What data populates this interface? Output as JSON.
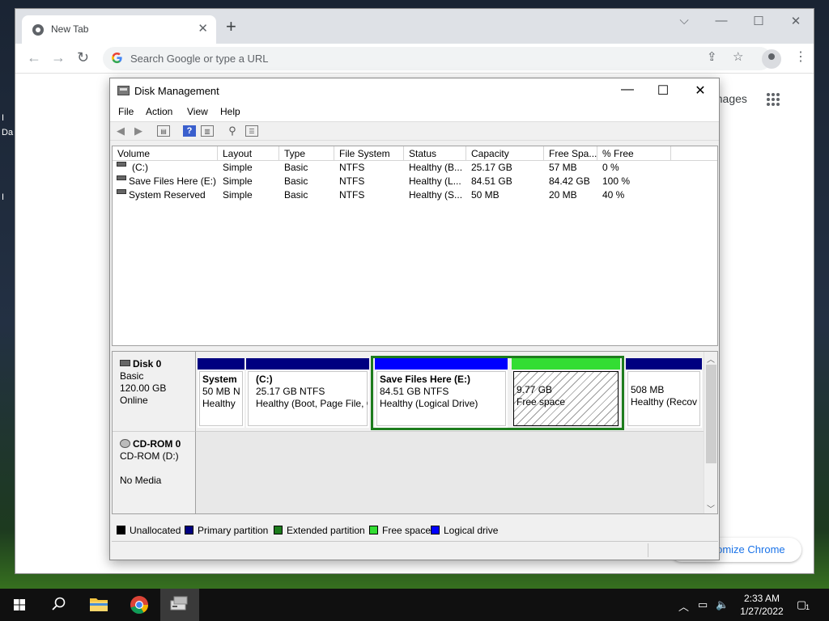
{
  "desktop": {
    "edge_letters": [
      "I",
      "Da",
      "I"
    ]
  },
  "chrome": {
    "tab_title": "New Tab",
    "omnibox_placeholder": "Search Google or type a URL",
    "images_link": "Images",
    "customize_button": "Customize Chrome",
    "customize_visible": "stomize Chrome"
  },
  "disk_management": {
    "title": "Disk Management",
    "menu": [
      "File",
      "Action",
      "View",
      "Help"
    ],
    "columns": [
      "Volume",
      "Layout",
      "Type",
      "File System",
      "Status",
      "Capacity",
      "Free Spa...",
      "% Free"
    ],
    "rows": [
      {
        "volume": "(C:)",
        "layout": "Simple",
        "type": "Basic",
        "fs": "NTFS",
        "status": "Healthy (B...",
        "capacity": "25.17 GB",
        "free": "57 MB",
        "pct": "0 %"
      },
      {
        "volume": "Save Files Here (E:)",
        "layout": "Simple",
        "type": "Basic",
        "fs": "NTFS",
        "status": "Healthy (L...",
        "capacity": "84.51 GB",
        "free": "84.42 GB",
        "pct": "100 %"
      },
      {
        "volume": "System Reserved",
        "layout": "Simple",
        "type": "Basic",
        "fs": "NTFS",
        "status": "Healthy (S...",
        "capacity": "50 MB",
        "free": "20 MB",
        "pct": "40 %"
      }
    ],
    "disk0": {
      "name": "Disk 0",
      "type": "Basic",
      "size": "120.00 GB",
      "state": "Online",
      "partitions": [
        {
          "name": "System",
          "line1": "50 MB N",
          "line2": "Healthy"
        },
        {
          "name": "(C:)",
          "line1": "25.17 GB NTFS",
          "line2": "Healthy (Boot, Page File, C"
        },
        {
          "name": "Save Files Here  (E:)",
          "line1": "84.51 GB NTFS",
          "line2": "Healthy (Logical Drive)"
        },
        {
          "name": "",
          "line1": "9.77 GB",
          "line2": "Free space"
        },
        {
          "name": "",
          "line1": "508 MB",
          "line2": "Healthy (Recov"
        }
      ]
    },
    "cdrom": {
      "name": "CD-ROM 0",
      "drive": "CD-ROM (D:)",
      "media": "No Media"
    },
    "legend": [
      {
        "label": "Unallocated",
        "color": "#000000"
      },
      {
        "label": "Primary partition",
        "color": "#000080"
      },
      {
        "label": "Extended partition",
        "color": "#1d7c1d"
      },
      {
        "label": "Free space",
        "color": "#33dd33"
      },
      {
        "label": "Logical drive",
        "color": "#0000ff"
      }
    ]
  },
  "taskbar": {
    "time": "2:33 AM",
    "date": "1/27/2022",
    "notification_count": "1"
  },
  "colors": {
    "primary_bar": "#000080",
    "logical_bar": "#0000ff",
    "free_bar": "#33dd33",
    "extended_border": "#1d7c1d"
  }
}
